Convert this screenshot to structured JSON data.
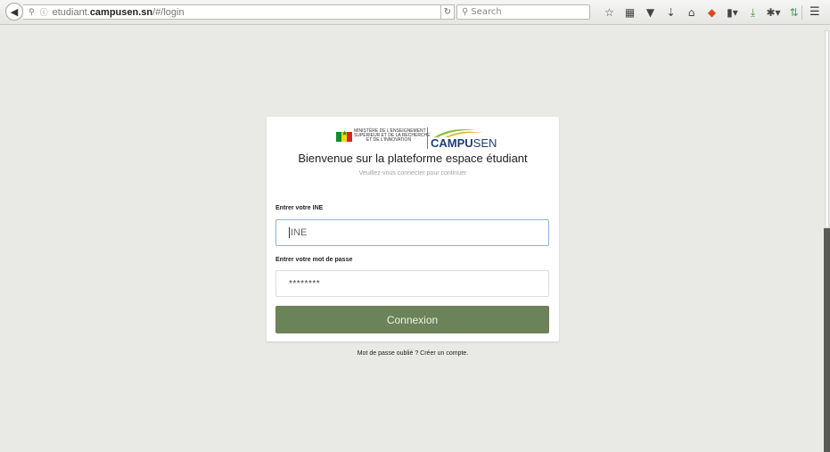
{
  "browser": {
    "url_host": "etudiant.",
    "url_domain": "campusen.sn",
    "url_path": "/#/login",
    "search_placeholder": "Search"
  },
  "logo": {
    "ministry_line1": "MINISTÈRE DE L'ENSEIGNEMENT",
    "ministry_line2": "SUPÉRIEUR ET DE LA RECHERCHE",
    "ministry_line3": "ET DE L'INNOVATION",
    "brand_bold": "CAMPU",
    "brand_light": "SEN",
    "brand_color": "#1d3e7a",
    "swoosh_colors": [
      "#8bbf3d",
      "#e0b32a"
    ]
  },
  "login": {
    "title": "Bienvenue sur la plateforme espace étudiant",
    "subtitle": "Veuillez-vous connecter pour continuer",
    "ine_label": "Entrer votre INE",
    "ine_placeholder": "INE",
    "password_label": "Entrer votre mot de passe",
    "password_value": "********",
    "submit_label": "Connexion",
    "submit_color": "#6c8259",
    "forgot_link": "Mot de passe oublié ?",
    "create_link": "Créer un compte."
  }
}
